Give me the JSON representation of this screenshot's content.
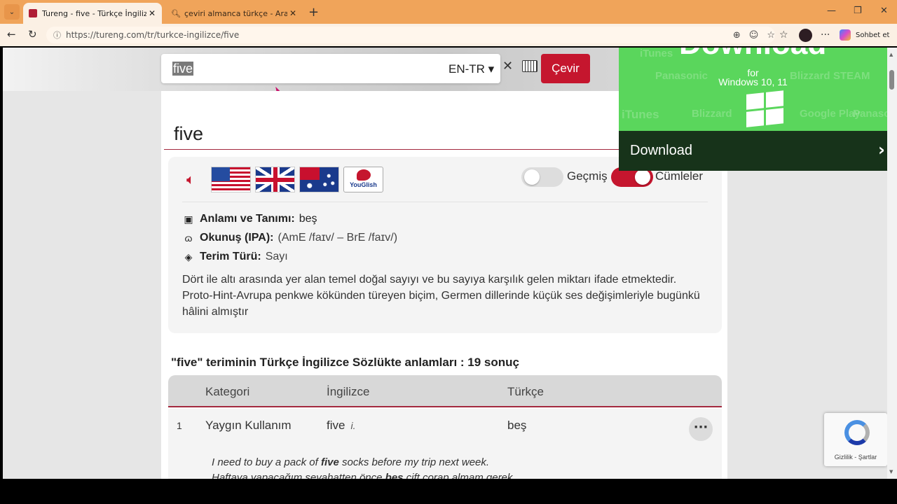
{
  "browser": {
    "tabs": [
      {
        "title": "Tureng - five - Türkçe İngilizce Söz",
        "active": true
      },
      {
        "title": "çeviri almanca türkçe - Arama",
        "active": false
      }
    ],
    "url": "https://tureng.com/tr/turkce-ingilizce/five",
    "copilot_label": "Sohbet et"
  },
  "search": {
    "value": "five",
    "lang": "EN-TR ▾",
    "button": "Çevir"
  },
  "word": {
    "title": "five",
    "toggles": {
      "history": "Geçmiş",
      "sentences": "Cümleler",
      "history_on": false,
      "sentences_on": true
    },
    "youglish": "YouGlish",
    "meaning_label": "Anlamı ve Tanımı:",
    "meaning": "beş",
    "ipa_label": "Okunuş (IPA):",
    "ipa": "(AmE /faɪv/ – BrE /faɪv/)",
    "type_label": "Terim Türü:",
    "type": "Sayı",
    "description": "Dört ile altı arasında yer alan temel doğal sayıyı ve bu sayıya karşılık gelen miktarı ifade etmektedir. Proto-Hint-Avrupa penkwe kökünden türeyen biçim, Germen dillerinde küçük ses değişimleriyle bugünkü hâlini almıştır"
  },
  "results": {
    "title": "\"five\" teriminin Türkçe İngilizce Sözlükte anlamları : 19 sonuç",
    "headers": {
      "category": "Kategori",
      "english": "İngilizce",
      "turkish": "Türkçe"
    },
    "rows": [
      {
        "num": "1",
        "category": "Yaygın Kullanım",
        "english": "five",
        "pos": "i.",
        "turkish": "beş",
        "more": "···"
      }
    ],
    "example": {
      "en_before": "I need to buy a pack of ",
      "en_bold": "five",
      "en_after": " socks before my trip next week.",
      "tr_before": "Haftaya yapacağım seyahatten önce ",
      "tr_bold": "beş",
      "tr_after": " çift çorap almam gerek."
    }
  },
  "ad": {
    "headline": "Download",
    "for": "for",
    "windows": "Windows 10, 11",
    "button": "Download",
    "brands": [
      "Panasonic",
      "iTunes",
      "Blizzard",
      "STEAM",
      "Google Play",
      "Panasonic",
      "Blizzard",
      "iTunes"
    ]
  },
  "recaptcha": {
    "links": "Gizlilik - Şartlar"
  },
  "colors": {
    "accent": "#c5162e",
    "rule": "#a3283e",
    "ad_green": "#5ad65c",
    "ad_dark": "#17331a",
    "tabbar": "#f0a45a"
  }
}
